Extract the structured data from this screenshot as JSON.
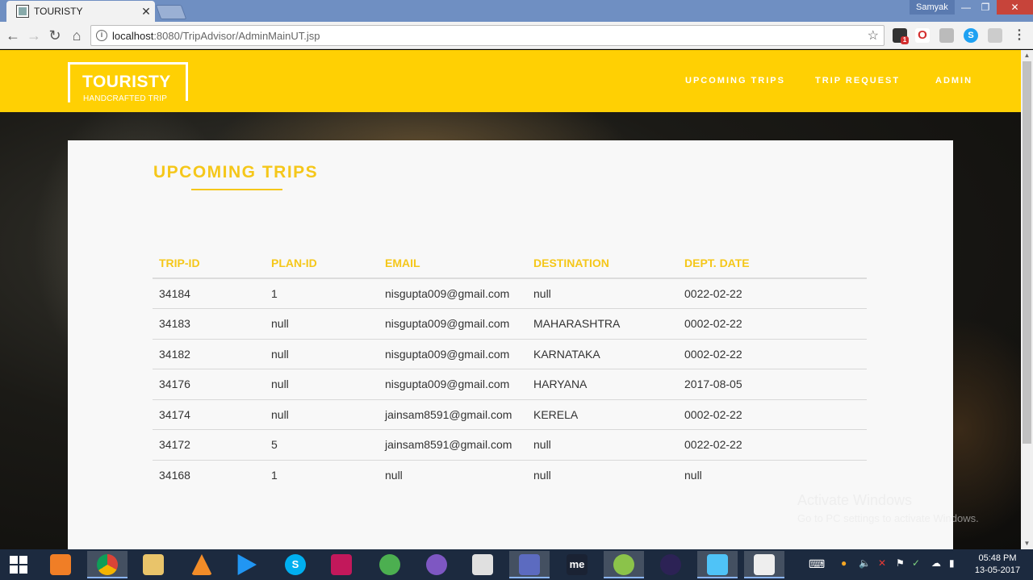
{
  "browser": {
    "tab_title": "TOURISTY",
    "tab_close": "✕",
    "profile_name": "Samyak",
    "url_host": "localhost",
    "url_path": ":8080/TripAdvisor/AdminMainUT.jsp",
    "window_min": "—",
    "window_max": "❐",
    "window_close": "✕",
    "ext_badge": "1"
  },
  "header": {
    "logo_title": "TOURISTY",
    "logo_subtitle": "HANDCRAFTED TRIP",
    "nav": [
      "UPCOMING TRIPS",
      "TRIP REQUEST",
      "ADMIN"
    ],
    "brand_color": "#ffd003"
  },
  "main": {
    "title": "UPCOMING TRIPS",
    "columns": [
      "TRIP-ID",
      "PLAN-ID",
      "EMAIL",
      "DESTINATION",
      "DEPT. DATE"
    ],
    "rows": [
      [
        "34184",
        "1",
        "nisgupta009@gmail.com",
        "null",
        "0022-02-22"
      ],
      [
        "34183",
        "null",
        "nisgupta009@gmail.com",
        "MAHARASHTRA",
        "0002-02-22"
      ],
      [
        "34182",
        "null",
        "nisgupta009@gmail.com",
        "KARNATAKA",
        "0002-02-22"
      ],
      [
        "34176",
        "null",
        "nisgupta009@gmail.com",
        "HARYANA",
        "2017-08-05"
      ],
      [
        "34174",
        "null",
        "jainsam8591@gmail.com",
        "KERELA",
        "0002-02-22"
      ],
      [
        "34172",
        "5",
        "jainsam8591@gmail.com",
        "null",
        "0022-02-22"
      ],
      [
        "34168",
        "1",
        "null",
        "null",
        "null"
      ]
    ],
    "accent_color": "#f5c71a"
  },
  "watermark": {
    "line1": "Activate Windows",
    "line2": "Go to PC settings to activate Windows."
  },
  "taskbar": {
    "time": "05:48 PM",
    "date": "13-05-2017",
    "me_label": "me"
  }
}
